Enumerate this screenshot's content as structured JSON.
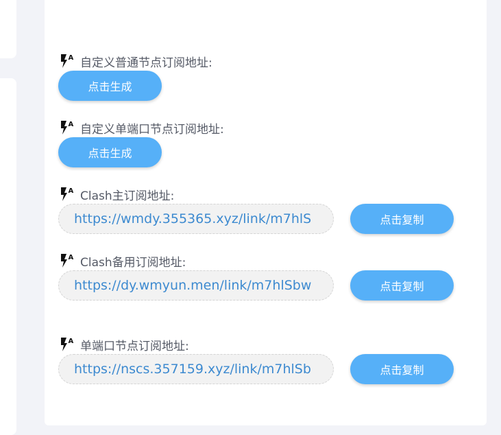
{
  "sections": [
    {
      "label": "自定义普通节点订阅地址:",
      "button": "点击生成"
    },
    {
      "label": "自定义单端口节点订阅地址:",
      "button": "点击生成"
    },
    {
      "label": "Clash主订阅地址:",
      "url": "https://wmdy.355365.xyz/link/m7hlS",
      "button": "点击复制"
    },
    {
      "label": "Clash备用订阅地址:",
      "url": "https://dy.wmyun.men/link/m7hlSbw",
      "button": "点击复制"
    },
    {
      "label": "单端口节点订阅地址:",
      "url": "https://nscs.357159.xyz/link/m7hlSb",
      "button": "点击复制"
    }
  ],
  "colors": {
    "accent": "#56b0f8",
    "url_text": "#3d8ad0",
    "label_text": "#555a66",
    "page_bg": "#f2f3f8"
  },
  "icons": {
    "label_icon": "flash-auto-icon"
  }
}
